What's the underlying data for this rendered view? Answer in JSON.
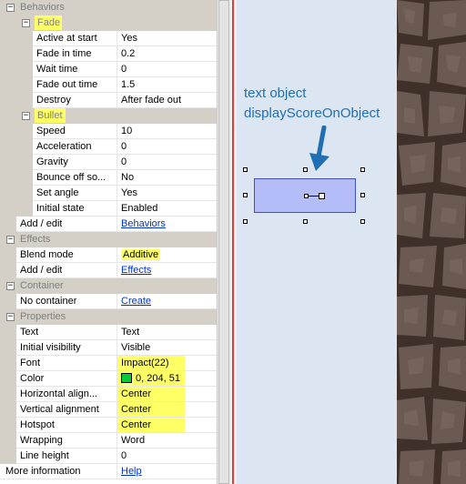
{
  "properties": {
    "behaviors_header": "Behaviors",
    "fade_group": "Fade",
    "active_at_start": {
      "label": "Active at start",
      "value": "Yes"
    },
    "fade_in_time": {
      "label": "Fade in time",
      "value": "0.2"
    },
    "wait_time": {
      "label": "Wait time",
      "value": "0"
    },
    "fade_out_time": {
      "label": "Fade out time",
      "value": "1.5"
    },
    "destroy": {
      "label": "Destroy",
      "value": "After fade out"
    },
    "bullet_group": "Bullet",
    "speed": {
      "label": "Speed",
      "value": "10"
    },
    "acceleration": {
      "label": "Acceleration",
      "value": "0"
    },
    "gravity": {
      "label": "Gravity",
      "value": "0"
    },
    "bounce_off": {
      "label": "Bounce off so...",
      "value": "No"
    },
    "set_angle": {
      "label": "Set angle",
      "value": "Yes"
    },
    "initial_state": {
      "label": "Initial state",
      "value": "Enabled"
    },
    "behaviors_add_edit": {
      "label": "Add / edit",
      "value": "Behaviors"
    },
    "effects_header": "Effects",
    "blend_mode": {
      "label": "Blend mode",
      "value": "Additive"
    },
    "effects_add_edit": {
      "label": "Add / edit",
      "value": "Effects"
    },
    "container_header": "Container",
    "no_container": {
      "label": "No container",
      "value": "Create"
    },
    "properties_header": "Properties",
    "text": {
      "label": "Text",
      "value": "Text"
    },
    "initial_visibility": {
      "label": "Initial visibility",
      "value": "Visible"
    },
    "font": {
      "label": "Font",
      "value": "Impact(22)"
    },
    "color": {
      "label": "Color",
      "value": "0, 204, 51",
      "swatch": "#00cc33"
    },
    "horizontal_alignment": {
      "label": "Horizontal align...",
      "value": "Center"
    },
    "vertical_alignment": {
      "label": "Vertical alignment",
      "value": "Center"
    },
    "hotspot": {
      "label": "Hotspot",
      "value": "Center"
    },
    "wrapping": {
      "label": "Wrapping",
      "value": "Word"
    },
    "line_height": {
      "label": "Line height",
      "value": "0"
    },
    "more_information": {
      "label": "More information",
      "value": "Help"
    }
  },
  "layout": {
    "annotation_line1": "text object",
    "annotation_line2": "displayScoreOnObject"
  },
  "colors": {
    "highlight": "#ffff66",
    "annotation": "#1f6fb2",
    "link": "#0033cc",
    "layout_bg": "#dce6f2",
    "selected_object": "#b4bdf7"
  }
}
